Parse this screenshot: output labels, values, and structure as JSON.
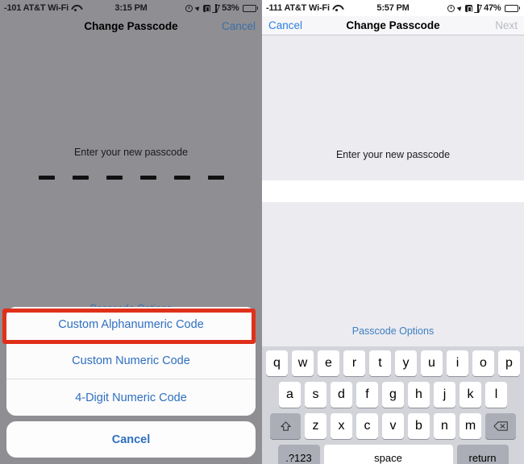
{
  "left": {
    "statusbar": {
      "carrier": "-101 AT&T Wi-Fi",
      "wifi_icon": "wifi-icon",
      "time": "3:15 PM",
      "alarm_icon": "alarm-icon",
      "location_icon": "location-arrow-icon",
      "rotation_lock_icon": "rotation-lock-icon",
      "bluetooth_icon": "bluetooth-icon",
      "battery_percent": "53%",
      "battery_icon": "battery-icon"
    },
    "navbar": {
      "title": "Change Passcode",
      "right_button": "Cancel"
    },
    "prompt": "Enter your new passcode",
    "dash_count": 6,
    "passcode_options_link": "Passcode Options",
    "sheet": {
      "items": [
        "Custom Alphanumeric Code",
        "Custom Numeric Code",
        "4-Digit Numeric Code"
      ],
      "cancel": "Cancel"
    },
    "highlight_color": "#e0301a"
  },
  "right": {
    "statusbar": {
      "carrier": "-111 AT&T Wi-Fi",
      "wifi_icon": "wifi-icon",
      "time": "5:57 PM",
      "alarm_icon": "alarm-icon",
      "location_icon": "location-arrow-icon",
      "rotation_lock_icon": "rotation-lock-icon",
      "bluetooth_icon": "bluetooth-icon",
      "battery_percent": "47%",
      "battery_icon": "battery-icon"
    },
    "navbar": {
      "left_button": "Cancel",
      "title": "Change Passcode",
      "right_button": "Next"
    },
    "prompt": "Enter your new passcode",
    "input_value": "",
    "passcode_options_link": "Passcode Options",
    "keyboard": {
      "row1": [
        "q",
        "w",
        "e",
        "r",
        "t",
        "y",
        "u",
        "i",
        "o",
        "p"
      ],
      "row2": [
        "a",
        "s",
        "d",
        "f",
        "g",
        "h",
        "j",
        "k",
        "l"
      ],
      "row3": [
        "z",
        "x",
        "c",
        "v",
        "b",
        "n",
        "m"
      ],
      "shift_icon": "shift-icon",
      "backspace_icon": "backspace-icon",
      "numbers_key": ".?123",
      "space_key": "space",
      "return_key": "return"
    }
  },
  "colors": {
    "ios_blue": "#2e7fe0",
    "sheet_blue": "#2e6fc0",
    "highlight_red": "#e0301a",
    "left_backdrop": "#8e8e93",
    "keyboard_bg": "#d2d4da"
  }
}
